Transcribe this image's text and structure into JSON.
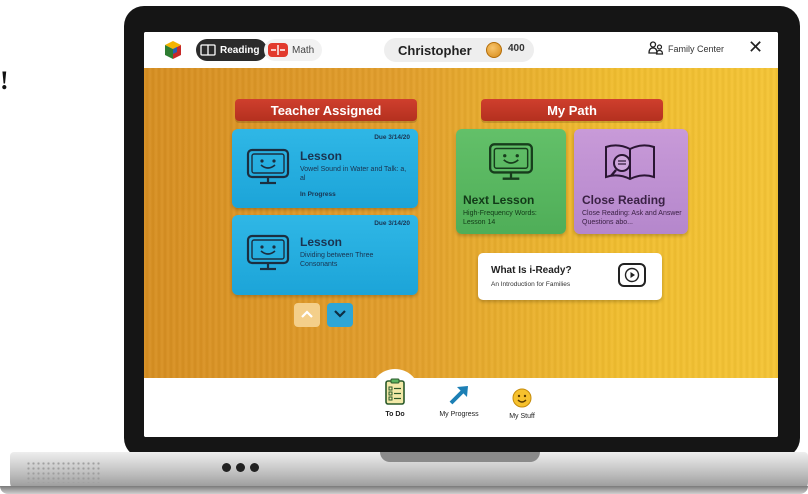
{
  "scrap_text": "!",
  "topbar": {
    "reading_tab": "Reading",
    "math_tab": "Math",
    "student_name": "Christopher",
    "coins": "400",
    "family_center": "Family Center",
    "close_symbol": "✕"
  },
  "teacher_assigned": {
    "header": "Teacher Assigned",
    "cards": [
      {
        "due": "Due 3/14/20",
        "title": "Lesson",
        "subtitle": "Vowel Sound in Water and Talk: a, al",
        "status": "In Progress"
      },
      {
        "due": "Due 3/14/20",
        "title": "Lesson",
        "subtitle": "Dividing between Three Consonants",
        "status": ""
      }
    ]
  },
  "my_path": {
    "header": "My Path",
    "next_lesson": {
      "title": "Next Lesson",
      "subtitle": "High-Frequency Words: Lesson 14"
    },
    "close_reading": {
      "title": "Close Reading",
      "subtitle": "Close Reading: Ask and Answer Questions abo..."
    },
    "whatis": {
      "title": "What Is i-Ready?",
      "subtitle": "An Introduction for Families"
    }
  },
  "bottom_nav": {
    "todo": "To Do",
    "progress": "My Progress",
    "stuff": "My Stuff"
  },
  "colors": {
    "banner_red": "#c0392b",
    "card_blue": "#22aadc",
    "card_green": "#57b45f",
    "card_purple": "#bf90d2",
    "background_gold": "#e9ad2c"
  },
  "icons": {
    "logo": "cube-logo-icon",
    "reading": "book-icon",
    "math": "math-icon",
    "coin": "coin-icon",
    "family": "family-icon",
    "close": "close-icon",
    "lesson": "smiling-monitor-icon",
    "close_reading": "book-magnifier-icon",
    "play": "play-icon",
    "todo": "checklist-icon",
    "progress": "arrow-up-right-icon",
    "stuff": "smiley-face-icon",
    "up": "chevron-up-icon",
    "down": "chevron-down-icon"
  }
}
